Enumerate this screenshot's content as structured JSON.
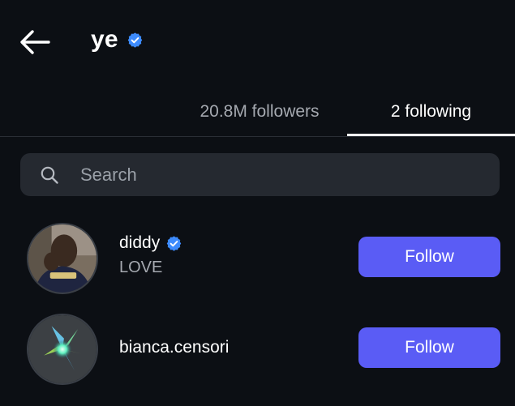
{
  "header": {
    "title": "ye",
    "verified": true
  },
  "tabs": [
    {
      "label": "20.8M followers",
      "active": false
    },
    {
      "label": "2 following",
      "active": true
    }
  ],
  "search": {
    "placeholder": "Search",
    "value": ""
  },
  "accounts": [
    {
      "username": "diddy",
      "verified": true,
      "subtitle": "LOVE",
      "button_label": "Follow"
    },
    {
      "username": "bianca.censori",
      "verified": false,
      "subtitle": "",
      "button_label": "Follow"
    }
  ],
  "colors": {
    "background": "#0c0f14",
    "accent_button": "#5a5cf5",
    "verified_badge": "#3d8bfd",
    "search_bg": "#252930"
  },
  "icons": {
    "back": "arrow-left-icon",
    "verified": "verified-badge-icon",
    "search": "search-icon"
  }
}
